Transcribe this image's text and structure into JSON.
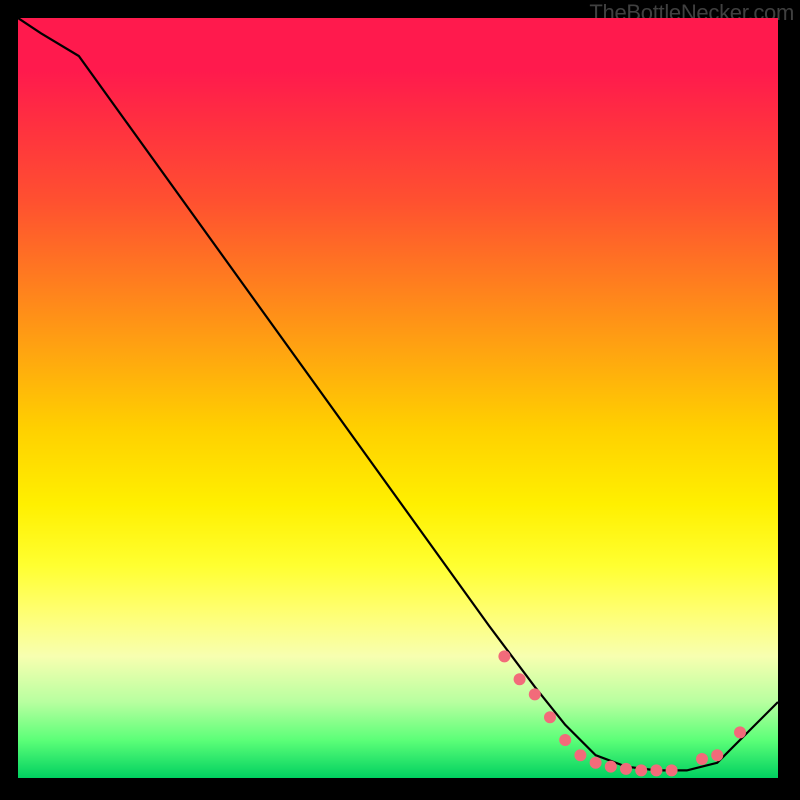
{
  "watermark": "TheBottleNecker.com",
  "chart_data": {
    "type": "line",
    "title": "",
    "xlabel": "",
    "ylabel": "",
    "xlim": [
      0,
      100
    ],
    "ylim": [
      0,
      100
    ],
    "series": [
      {
        "name": "curve",
        "x": [
          0,
          3,
          8,
          62,
          68,
          72,
          76,
          80,
          84,
          88,
          92,
          96,
          100
        ],
        "y": [
          100,
          98,
          95,
          20,
          12,
          7,
          3,
          1.5,
          1,
          1,
          2,
          6,
          10
        ]
      }
    ],
    "markers": {
      "name": "highlight-points",
      "color": "#f26b7a",
      "x": [
        64,
        66,
        68,
        70,
        72,
        74,
        76,
        78,
        80,
        82,
        84,
        86,
        90,
        92,
        95
      ],
      "y": [
        16,
        13,
        11,
        8,
        5,
        3,
        2,
        1.5,
        1.2,
        1,
        1,
        1,
        2.5,
        3,
        6
      ]
    },
    "gradient_stops": [
      {
        "pos": 0,
        "color": "#ff1a4d"
      },
      {
        "pos": 50,
        "color": "#ffe000"
      },
      {
        "pos": 80,
        "color": "#ffff80"
      },
      {
        "pos": 100,
        "color": "#00d060"
      }
    ]
  }
}
